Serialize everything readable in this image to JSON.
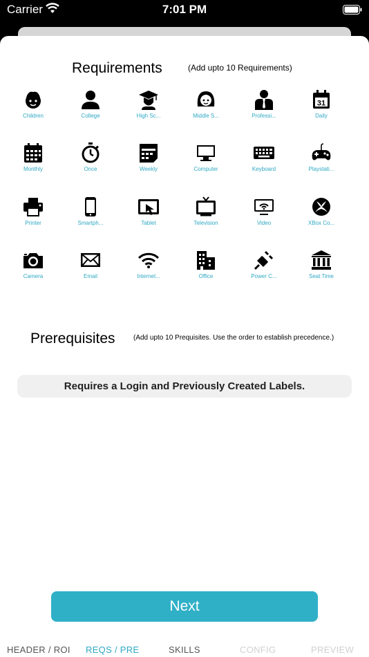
{
  "status_bar": {
    "carrier": "Carrier",
    "time": "7:01 PM"
  },
  "requirements": {
    "title": "Requirements",
    "note": "(Add upto 10 Requirements)",
    "items": [
      {
        "label": "Children",
        "icon": "child-face-icon"
      },
      {
        "label": "College",
        "icon": "person-icon"
      },
      {
        "label": "High Sc...",
        "icon": "graduate-icon"
      },
      {
        "label": "Middle S...",
        "icon": "girl-face-icon"
      },
      {
        "label": "Professi...",
        "icon": "professional-icon"
      },
      {
        "label": "Daily",
        "icon": "calendar-day-icon"
      },
      {
        "label": "Monthly",
        "icon": "calendar-month-icon"
      },
      {
        "label": "Once",
        "icon": "stopwatch-icon"
      },
      {
        "label": "Weekly",
        "icon": "calendar-week-icon"
      },
      {
        "label": "Computer",
        "icon": "computer-icon"
      },
      {
        "label": "Keyboard",
        "icon": "keyboard-icon"
      },
      {
        "label": "Playstati...",
        "icon": "gamepad-icon"
      },
      {
        "label": "Printer",
        "icon": "printer-icon"
      },
      {
        "label": "Smartph...",
        "icon": "smartphone-icon"
      },
      {
        "label": "Tablet",
        "icon": "tablet-icon"
      },
      {
        "label": "Television",
        "icon": "television-icon"
      },
      {
        "label": "Video",
        "icon": "video-icon"
      },
      {
        "label": "XBox Co...",
        "icon": "xbox-icon"
      },
      {
        "label": "Camera",
        "icon": "camera-icon"
      },
      {
        "label": "Email",
        "icon": "email-icon"
      },
      {
        "label": "Internet...",
        "icon": "wifi-icon"
      },
      {
        "label": "Office",
        "icon": "office-icon"
      },
      {
        "label": "Power C...",
        "icon": "power-cord-icon"
      },
      {
        "label": "Seat Time",
        "icon": "institution-icon"
      }
    ]
  },
  "prerequisites": {
    "title": "Prerequisites",
    "note": "(Add upto 10 Prequisites. Use the order to establish precedence.)",
    "message": "Requires a Login and Previously Created Labels."
  },
  "next_label": "Next",
  "tabs": [
    {
      "label": "HEADER / ROI",
      "state": "normal"
    },
    {
      "label": "REQS / PRE",
      "state": "active"
    },
    {
      "label": "SKILLS",
      "state": "normal"
    },
    {
      "label": "CONFIG",
      "state": "disabled"
    },
    {
      "label": "PREVIEW",
      "state": "disabled"
    }
  ],
  "colors": {
    "accent": "#2fb0c7",
    "tab_active": "#2ea8c3",
    "tab_normal": "#555555",
    "tab_disabled": "#d0d0d0",
    "icon_label": "#2ea8c3"
  }
}
